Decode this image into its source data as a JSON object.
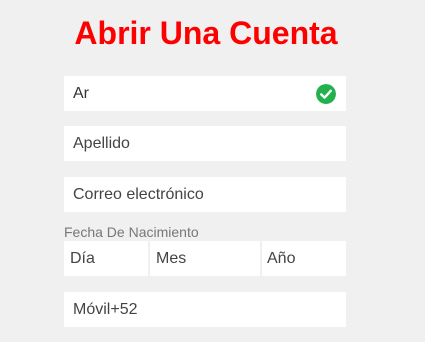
{
  "form": {
    "title": "Abrir Una Cuenta",
    "title_color": "#ff0000",
    "first_name_value": "Ar",
    "first_name_status_color": "#22b14c",
    "last_name_placeholder": "Apellido",
    "email_placeholder": "Correo electrónico",
    "birthdate_label": "Fecha De Nacimiento",
    "day_placeholder": "Día",
    "month_placeholder": "Mes",
    "year_placeholder": "Año",
    "mobile_label": "Móvil",
    "country_code": "+52"
  }
}
